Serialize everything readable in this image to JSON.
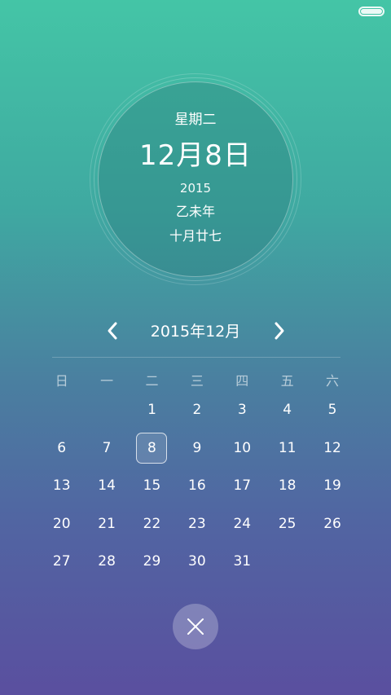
{
  "status": {
    "battery_icon": "battery-icon",
    "battery_level": 1.0
  },
  "date_panel": {
    "weekday": "星期二",
    "date": "12月8日",
    "year": "2015",
    "ganzhi": "乙未年",
    "lunar": "十月廿七"
  },
  "month_nav": {
    "title": "2015年12月",
    "prev_icon": "chevron-left-icon",
    "next_icon": "chevron-right-icon"
  },
  "calendar": {
    "weekdays": [
      "日",
      "一",
      "二",
      "三",
      "四",
      "五",
      "六"
    ],
    "weeks": [
      [
        "",
        "",
        "1",
        "2",
        "3",
        "4",
        "5"
      ],
      [
        "6",
        "7",
        "8",
        "9",
        "10",
        "11",
        "12"
      ],
      [
        "13",
        "14",
        "15",
        "16",
        "17",
        "18",
        "19"
      ],
      [
        "20",
        "21",
        "22",
        "23",
        "24",
        "25",
        "26"
      ],
      [
        "27",
        "28",
        "29",
        "30",
        "31",
        "",
        ""
      ]
    ],
    "selected_day": "8"
  },
  "close": {
    "icon": "close-icon"
  }
}
